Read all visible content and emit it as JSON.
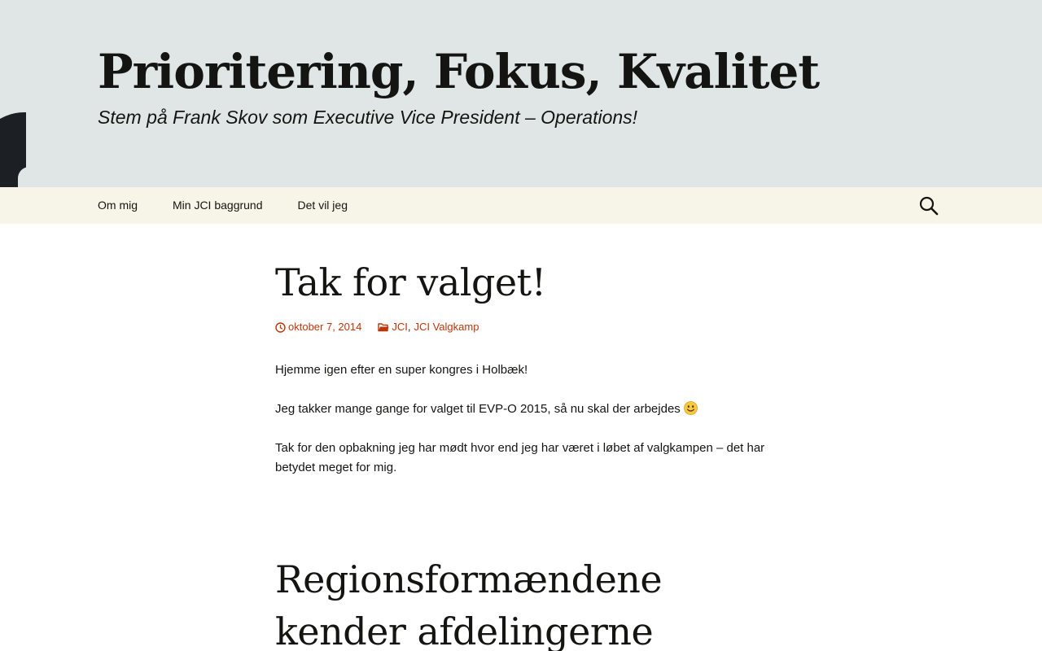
{
  "site": {
    "title": "Prioritering, Fokus, Kvalitet",
    "description": "Stem på Frank Skov som Executive Vice President – Operations!"
  },
  "nav": {
    "items": [
      {
        "label": "Om mig"
      },
      {
        "label": "Min JCI baggrund"
      },
      {
        "label": "Det vil jeg"
      }
    ],
    "search_icon": "search-icon"
  },
  "posts": [
    {
      "title": "Tak for valget!",
      "date": "oktober 7, 2014",
      "date_icon": "clock-icon",
      "category_icon": "folder-icon",
      "categories": [
        "JCI",
        "JCI Valgkamp"
      ],
      "category_separator": ",",
      "paragraphs": [
        "Hjemme igen efter en super kongres i Holbæk!",
        "Jeg takker mange gange for valget til EVP-O 2015, så nu skal der arbejdes",
        "Tak for den opbakning jeg har mødt hvor end jeg har været i løbet af valgkampen – det har betydet meget for mig."
      ],
      "emoji_icon": "smiley-icon"
    },
    {
      "title_line1": "Regionsformændene",
      "title_line2": "kender afdelingerne"
    }
  ],
  "colors": {
    "header_bg": "#dfe6e5",
    "nav_bg": "#f7f5e7",
    "link_accent": "#bc360a",
    "text": "#141412"
  }
}
